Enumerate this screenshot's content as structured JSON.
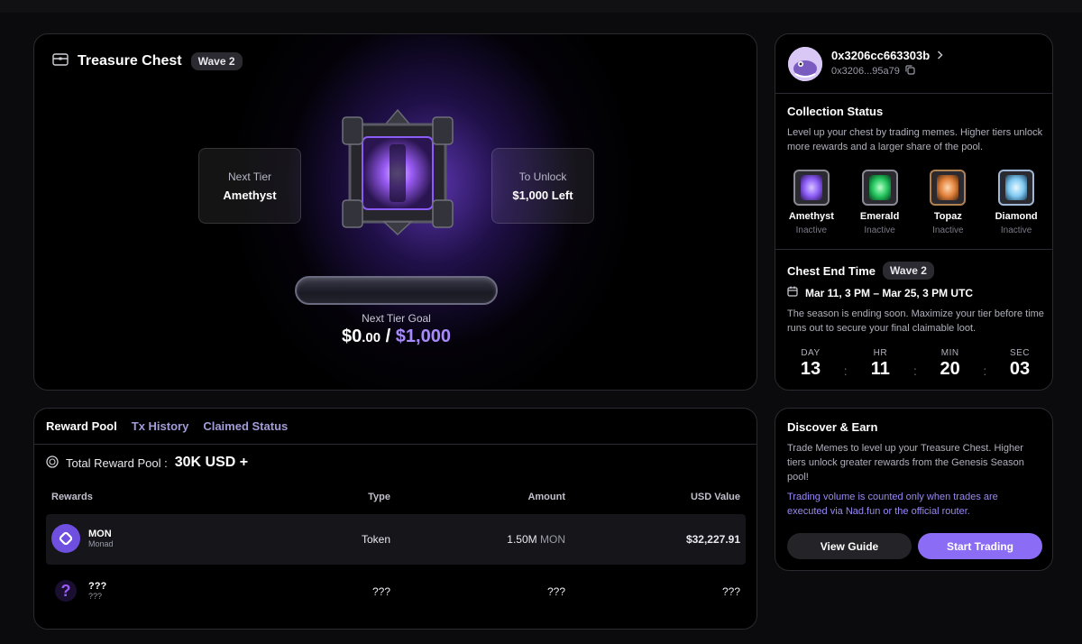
{
  "chest": {
    "title": "Treasure Chest",
    "wave": "Wave 2",
    "next_tier_label": "Next Tier",
    "next_tier_value": "Amethyst",
    "unlock_label": "To Unlock",
    "unlock_value": "$1,000 Left",
    "progress_fraction": 0,
    "goal_label": "Next Tier Goal",
    "goal_current_main": "$0",
    "goal_current_cents": ".00",
    "goal_sep": " / ",
    "goal_target": "$1,000"
  },
  "profile": {
    "address": "0x3206cc663303b",
    "address_short": "0x3206...95a79"
  },
  "collection": {
    "title": "Collection Status",
    "description": "Level up your chest by trading memes. Higher tiers unlock more rewards and a larger share of the pool.",
    "tiers": [
      {
        "name": "Amethyst",
        "status": "Inactive",
        "color": "#8b5cf6"
      },
      {
        "name": "Emerald",
        "status": "Inactive",
        "color": "#22c55e"
      },
      {
        "name": "Topaz",
        "status": "Inactive",
        "color": "#e0803a"
      },
      {
        "name": "Diamond",
        "status": "Inactive",
        "color": "#7ec8f0"
      }
    ]
  },
  "end_time": {
    "title": "Chest End Time",
    "wave": "Wave 2",
    "range": "Mar 11, 3 PM – Mar 25, 3 PM UTC",
    "description": "The season is ending soon. Maximize your tier before time runs out to secure your final claimable loot.",
    "countdown": [
      {
        "unit": "DAY",
        "value": "13"
      },
      {
        "unit": "HR",
        "value": "11"
      },
      {
        "unit": "MIN",
        "value": "20"
      },
      {
        "unit": "SEC",
        "value": "03"
      }
    ]
  },
  "reward": {
    "tabs": [
      "Reward Pool",
      "Tx History",
      "Claimed Status"
    ],
    "total_label": "Total Reward Pool :",
    "total_value": "30K USD +",
    "columns": [
      "Rewards",
      "Type",
      "Amount",
      "USD Value"
    ],
    "rows": [
      {
        "name": "MON",
        "sub": "Monad",
        "type": "Token",
        "amount": "1.50M",
        "unit": "MON",
        "usd": "$32,227.91"
      },
      {
        "name": "???",
        "sub": "???",
        "type": "???",
        "amount": "???",
        "unit": "",
        "usd": "???"
      }
    ]
  },
  "discover": {
    "title": "Discover & Earn",
    "description": "Trade Memes to level up your Treasure Chest. Higher tiers unlock greater rewards from the Genesis Season pool!",
    "note": "Trading volume is counted only when trades are executed via Nad.fun or the official router.",
    "guide_label": "View Guide",
    "trade_label": "Start Trading"
  },
  "colors": {
    "accent": "#8b6cf5",
    "accent_text": "#a78bfa"
  }
}
